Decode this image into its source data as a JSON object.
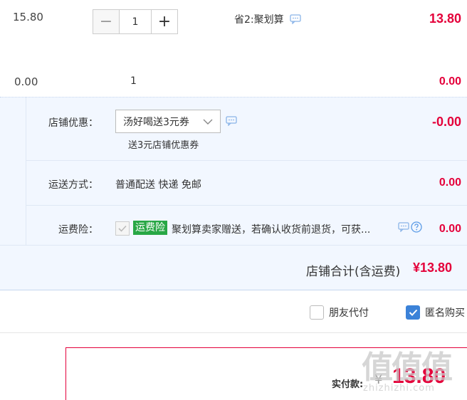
{
  "item": {
    "unit_price": "15.80",
    "quantity": "1",
    "minus_label": "−",
    "plus_label": "+",
    "promo_text": "省2:聚划算",
    "subtotal": "13.80"
  },
  "gift_row": {
    "unit_price": "0.00",
    "quantity": "1",
    "subtotal": "0.00"
  },
  "coupon": {
    "label": "店铺优惠：",
    "selected": "汤好喝送3元券",
    "note": "送3元店铺优惠券",
    "amount": "-0.00"
  },
  "shipping": {
    "label": "运送方式：",
    "value": "普通配送 快递 免邮",
    "amount": "0.00"
  },
  "insurance": {
    "label": "运费险：",
    "badge": "运费险",
    "text": "聚划算卖家赠送，若确认收货前退货，可获...",
    "amount": "0.00"
  },
  "store_total": {
    "label": "店铺合计(含运费)",
    "amount": "¥13.80"
  },
  "options": {
    "friend_pay": "朋友代付",
    "anonymous": "匿名购买"
  },
  "payment": {
    "label": "实付款:",
    "currency": "¥",
    "amount": "13.80"
  },
  "watermark": {
    "main": "值值值",
    "sub": "zhizhizhi.com"
  },
  "colors": {
    "price_red": "#e4003a",
    "panel_blue": "#f2f7ff",
    "badge_green": "#28a745",
    "checkbox_blue": "#3b82d8"
  }
}
